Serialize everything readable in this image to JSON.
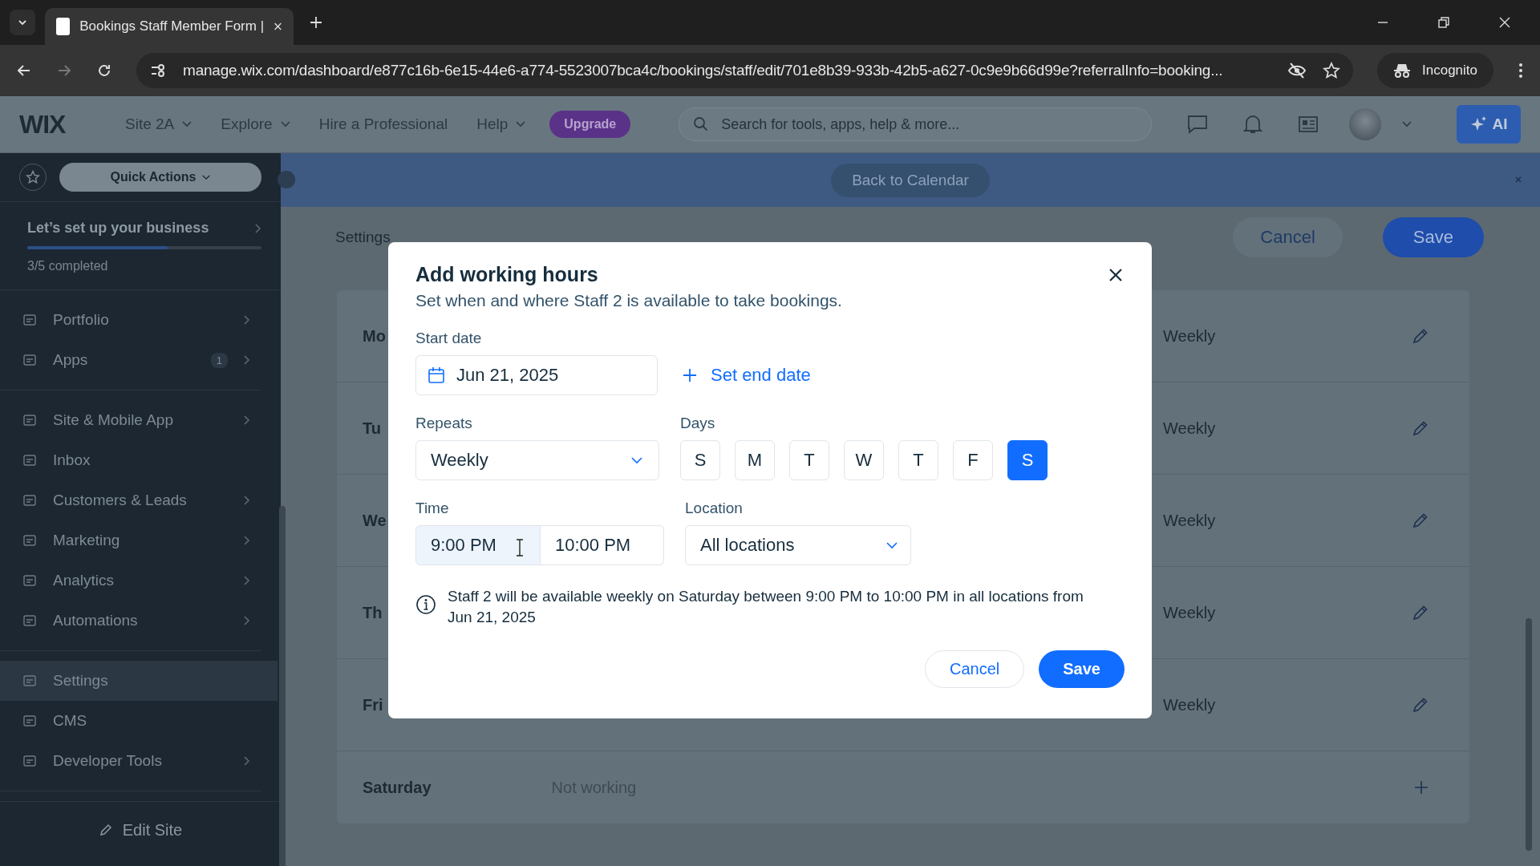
{
  "browser": {
    "tab_title": "Bookings Staff Member Form |",
    "url": "manage.wix.com/dashboard/e877c16b-6e15-44e6-a774-5523007bca4c/bookings/staff/edit/701e8b39-933b-42b5-a627-0c9e9b66d99e?referralInfo=booking...",
    "profile": "Incognito"
  },
  "topbar": {
    "logo": "WIX",
    "menu": [
      {
        "label": "Site 2A",
        "dropdown": true
      },
      {
        "label": "Explore",
        "dropdown": true
      },
      {
        "label": "Hire a Professional",
        "dropdown": false
      },
      {
        "label": "Help",
        "dropdown": true
      }
    ],
    "upgrade": "Upgrade",
    "search": {
      "placeholder": "Search for tools, apps, help & more..."
    },
    "ai": "AI"
  },
  "sidebar": {
    "quick_actions": "Quick Actions",
    "setup": {
      "title": "Let’s set up your business",
      "level": 0.6,
      "progress": "3/5 completed"
    },
    "groups": [
      [
        {
          "label": "Portfolio",
          "chevron": true,
          "selected": false
        },
        {
          "label": "Apps",
          "badge": "1",
          "chevron": true,
          "selected": false
        }
      ],
      [
        {
          "label": "Site & Mobile App",
          "chevron": true,
          "selected": false
        },
        {
          "label": "Inbox",
          "chevron": false,
          "selected": false
        },
        {
          "label": "Customers & Leads",
          "chevron": true,
          "selected": false
        },
        {
          "label": "Marketing",
          "chevron": true,
          "selected": false
        },
        {
          "label": "Analytics",
          "chevron": true,
          "selected": false
        },
        {
          "label": "Automations",
          "chevron": true,
          "selected": false
        }
      ],
      [
        {
          "label": "Settings",
          "chevron": false,
          "selected": true
        },
        {
          "label": "CMS",
          "chevron": false,
          "selected": false
        },
        {
          "label": "Developer Tools",
          "chevron": true,
          "selected": false
        }
      ]
    ],
    "edit_site": "Edit Site"
  },
  "banner": {
    "button": "Back to Calendar"
  },
  "page": {
    "breadcrumb": "Settings",
    "cancel": "Cancel",
    "save": "Save",
    "rows": [
      {
        "kind": "working",
        "day": "Mo",
        "repeat": "Weekly"
      },
      {
        "kind": "working",
        "day": "Tu",
        "repeat": "Weekly"
      },
      {
        "kind": "working",
        "day": "We",
        "repeat": "Weekly"
      },
      {
        "kind": "working",
        "day": "Th",
        "repeat": "Weekly"
      },
      {
        "kind": "working",
        "day": "Fri",
        "repeat": "Weekly"
      },
      {
        "kind": "off",
        "day": "Saturday",
        "status": "Not working"
      }
    ]
  },
  "modal": {
    "title": "Add working hours",
    "subtitle": "Set when and where Staff 2 is available to take bookings.",
    "start_date": {
      "label": "Start date",
      "value": "Jun 21, 2025"
    },
    "set_end_date": "Set end date",
    "repeats": {
      "label": "Repeats",
      "value": "Weekly"
    },
    "days": {
      "label": "Days",
      "items": [
        {
          "label": "S",
          "selected": false
        },
        {
          "label": "M",
          "selected": false
        },
        {
          "label": "T",
          "selected": false
        },
        {
          "label": "W",
          "selected": false
        },
        {
          "label": "T",
          "selected": false
        },
        {
          "label": "F",
          "selected": false
        },
        {
          "label": "S",
          "selected": true
        }
      ]
    },
    "time": {
      "label": "Time",
      "start": "9:00 PM",
      "end": "10:00 PM"
    },
    "location": {
      "label": "Location",
      "value": "All locations"
    },
    "info": "Staff 2 will be available weekly on Saturday between 9:00 PM to 10:00 PM in all locations from Jun 21, 2025",
    "cancel": "Cancel",
    "save": "Save"
  }
}
